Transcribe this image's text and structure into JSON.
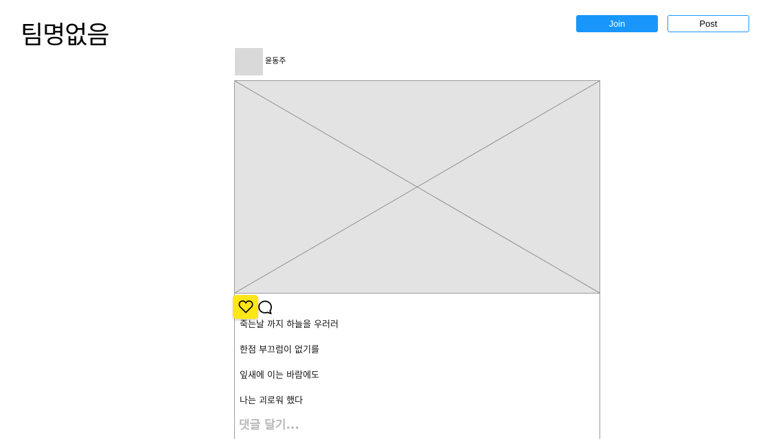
{
  "header": {
    "brand": "팀명없음",
    "join_label": "Join",
    "post_label": "Post"
  },
  "post": {
    "username": "윤동주",
    "image_alt": "image placeholder",
    "caption_lines": [
      "죽는날 까지 하늘을 우러러",
      "한점 부끄럼이 없기를",
      "잎새에 이는 바람에도",
      "나는 괴로워 했다"
    ],
    "actions": {
      "like_icon": "heart-icon",
      "comment_icon": "comment-bubble-icon"
    },
    "comment_placeholder": "댓글 달기..."
  },
  "colors": {
    "accent": "#1996fc",
    "like_highlight": "#ffe617",
    "placeholder_fill": "#e3e3e3",
    "avatar_fill": "#d9d9d9"
  }
}
